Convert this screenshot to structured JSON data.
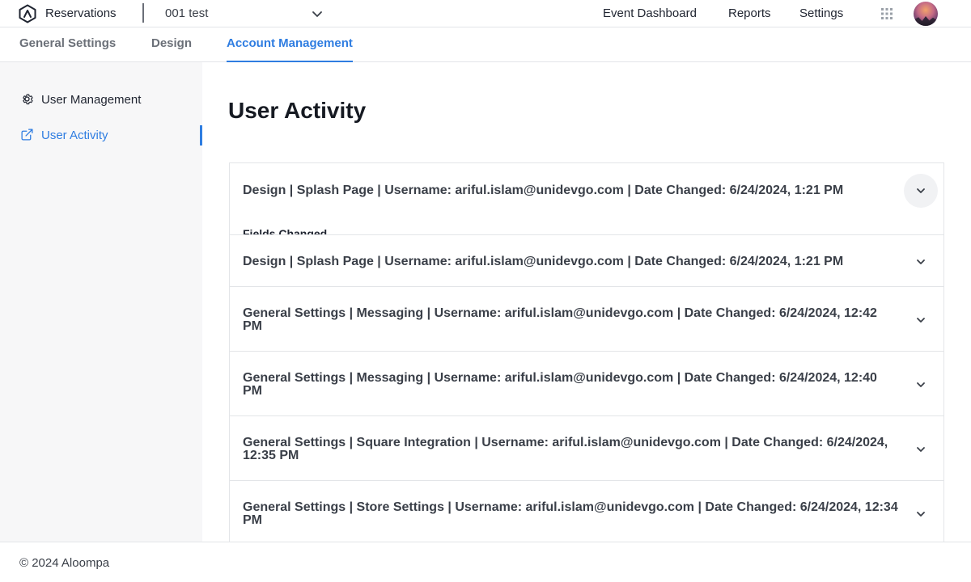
{
  "header": {
    "app_name": "Reservations",
    "logo_icon": "reservations-logo-icon",
    "venue": "001 test",
    "nav": [
      "Event Dashboard",
      "Reports",
      "Settings"
    ],
    "apps_icon": "grid-icon",
    "avatar_icon": "avatar"
  },
  "tabs": [
    {
      "label": "General Settings",
      "active": false
    },
    {
      "label": "Design",
      "active": false
    },
    {
      "label": "Account Management",
      "active": true
    }
  ],
  "sidebar": {
    "items": [
      {
        "label": "User Management",
        "icon": "gear-icon",
        "active": false
      },
      {
        "label": "User Activity",
        "icon": "external-link-icon",
        "active": true
      }
    ]
  },
  "main": {
    "title": "User Activity",
    "activities": [
      {
        "title": "Design | Splash Page | Username: ariful.islam@unidevgo.com | Date Changed: 6/24/2024, 1:21 PM",
        "expanded": true,
        "detail_label": "Fields Changed"
      },
      {
        "title": "Design | Splash Page | Username: ariful.islam@unidevgo.com | Date Changed: 6/24/2024, 1:21 PM",
        "expanded": false
      },
      {
        "title": "General Settings | Messaging | Username: ariful.islam@unidevgo.com | Date Changed: 6/24/2024, 12:42 PM",
        "expanded": false
      },
      {
        "title": "General Settings | Messaging | Username: ariful.islam@unidevgo.com | Date Changed: 6/24/2024, 12:40 PM",
        "expanded": false
      },
      {
        "title": "General Settings | Square Integration | Username: ariful.islam@unidevgo.com | Date Changed: 6/24/2024, 12:35 PM",
        "expanded": false
      },
      {
        "title": "General Settings | Store Settings | Username: ariful.islam@unidevgo.com | Date Changed: 6/24/2024, 12:34 PM",
        "expanded": false
      }
    ]
  },
  "colors": {
    "accent": "#2f7de1",
    "sidebar_bg": "#f7f7f8",
    "border": "#e3e5e8"
  },
  "footer": {
    "text": "© 2024 Aloompa"
  }
}
